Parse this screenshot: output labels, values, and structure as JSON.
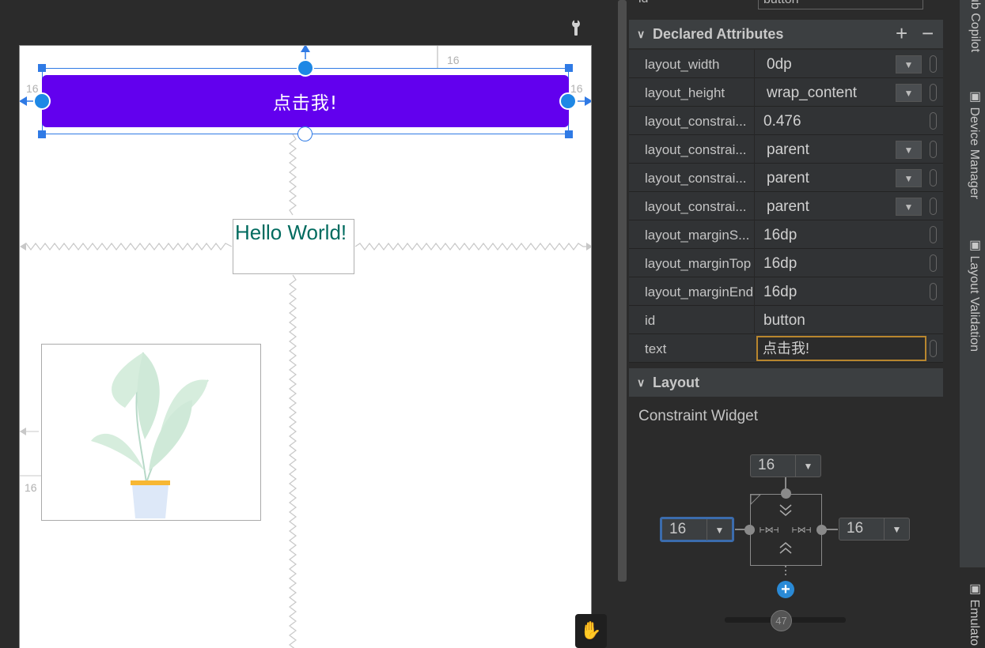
{
  "canvas": {
    "button_text": "点击我!",
    "hello_text": "Hello World!",
    "margin_top": "16",
    "margin_start": "16",
    "margin_end": "16",
    "image_margin": "16"
  },
  "attributes": {
    "id_row": {
      "label": "id",
      "value": "button"
    },
    "section_title": "Declared Attributes",
    "rows": [
      {
        "name": "layout_width",
        "value": "0dp",
        "dropdown": true
      },
      {
        "name": "layout_height",
        "value": "wrap_content",
        "dropdown": true
      },
      {
        "name": "layout_constrai...",
        "value": "0.476",
        "dropdown": false
      },
      {
        "name": "layout_constrai...",
        "value": "parent",
        "dropdown": true
      },
      {
        "name": "layout_constrai...",
        "value": "parent",
        "dropdown": true
      },
      {
        "name": "layout_constrai...",
        "value": "parent",
        "dropdown": true
      },
      {
        "name": "layout_marginS...",
        "value": "16dp",
        "dropdown": false
      },
      {
        "name": "layout_marginTop",
        "value": "16dp",
        "dropdown": false
      },
      {
        "name": "layout_marginEnd",
        "value": "16dp",
        "dropdown": false
      },
      {
        "name": "id",
        "value": "button",
        "dropdown": false
      },
      {
        "name": "text",
        "value": "点击我!",
        "dropdown": false
      }
    ]
  },
  "layout_section": {
    "title": "Layout",
    "widget_title": "Constraint Widget",
    "top_margin": "16",
    "start_margin": "16",
    "end_margin": "16",
    "bias": "47"
  },
  "tool_strip": {
    "tabs": [
      "ub Copilot",
      "Device Manager",
      "Layout Validation",
      "Emulato"
    ]
  },
  "colors": {
    "button_bg": "#6200ee",
    "hello_text": "#006b5f",
    "selection": "#2f7ae5",
    "active_field_border": "#b8862e"
  }
}
